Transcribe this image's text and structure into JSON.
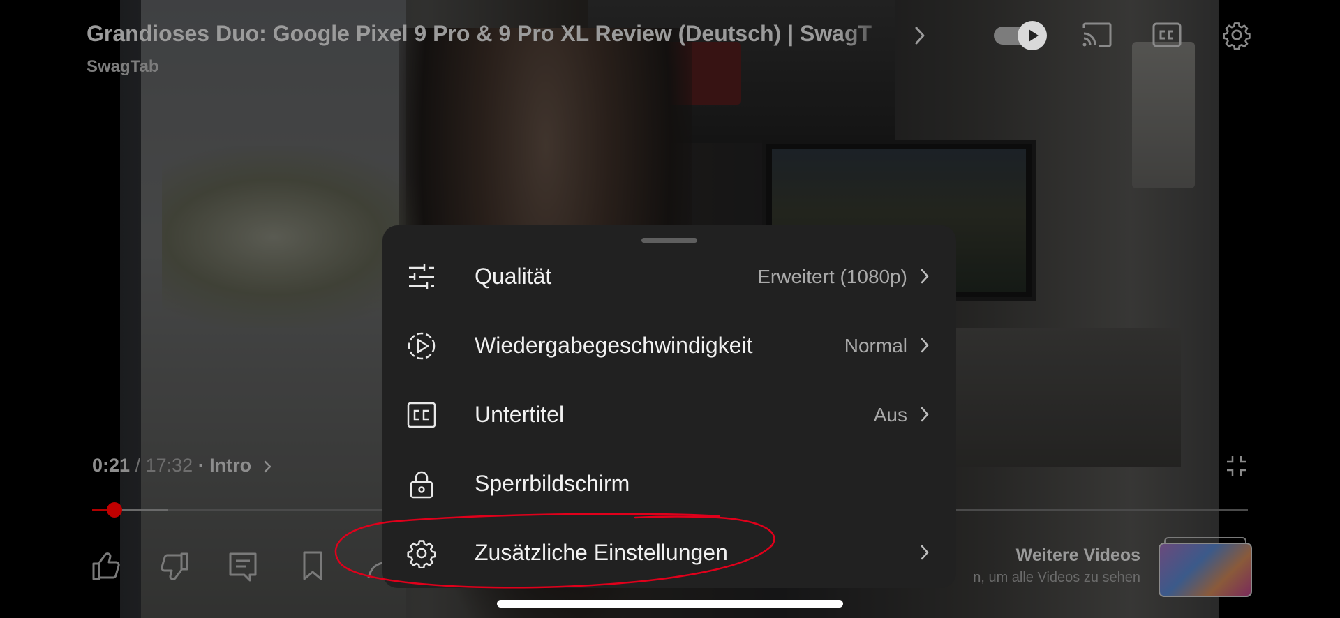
{
  "video": {
    "title": "Grandioses Duo: Google Pixel 9 Pro & 9 Pro XL Review (Deutsch) | SwagT",
    "channel": "SwagTab",
    "current_time": "0:21",
    "separator": "/",
    "duration": "17:32",
    "chapter": "· Intro",
    "progress_fraction": 0.0195,
    "buffer_fraction": 0.066
  },
  "top_controls": {
    "autoplay_icon": "autoplay-toggle-icon",
    "cast_icon": "cast-icon",
    "captions_icon": "cc-icon",
    "settings_icon": "gear-icon"
  },
  "settings_menu": {
    "items": [
      {
        "icon": "sliders-icon",
        "label": "Qualität",
        "value": "Erweitert (1080p)",
        "has_chevron": true
      },
      {
        "icon": "playback-speed-icon",
        "label": "Wiedergabegeschwindigkeit",
        "value": "Normal",
        "has_chevron": true
      },
      {
        "icon": "cc-icon",
        "label": "Untertitel",
        "value": "Aus",
        "has_chevron": true
      },
      {
        "icon": "lock-icon",
        "label": "Sperrbildschirm",
        "value": "",
        "has_chevron": false
      },
      {
        "icon": "gear-icon",
        "label": "Zusätzliche Einstellungen",
        "value": "",
        "has_chevron": true
      }
    ]
  },
  "more_videos": {
    "title": "Weitere Videos",
    "subtitle": "n, um alle Videos zu sehen"
  },
  "colors": {
    "progress_red": "#c00000",
    "sheet_bg": "#212121",
    "annotation_red": "#e0001b"
  }
}
